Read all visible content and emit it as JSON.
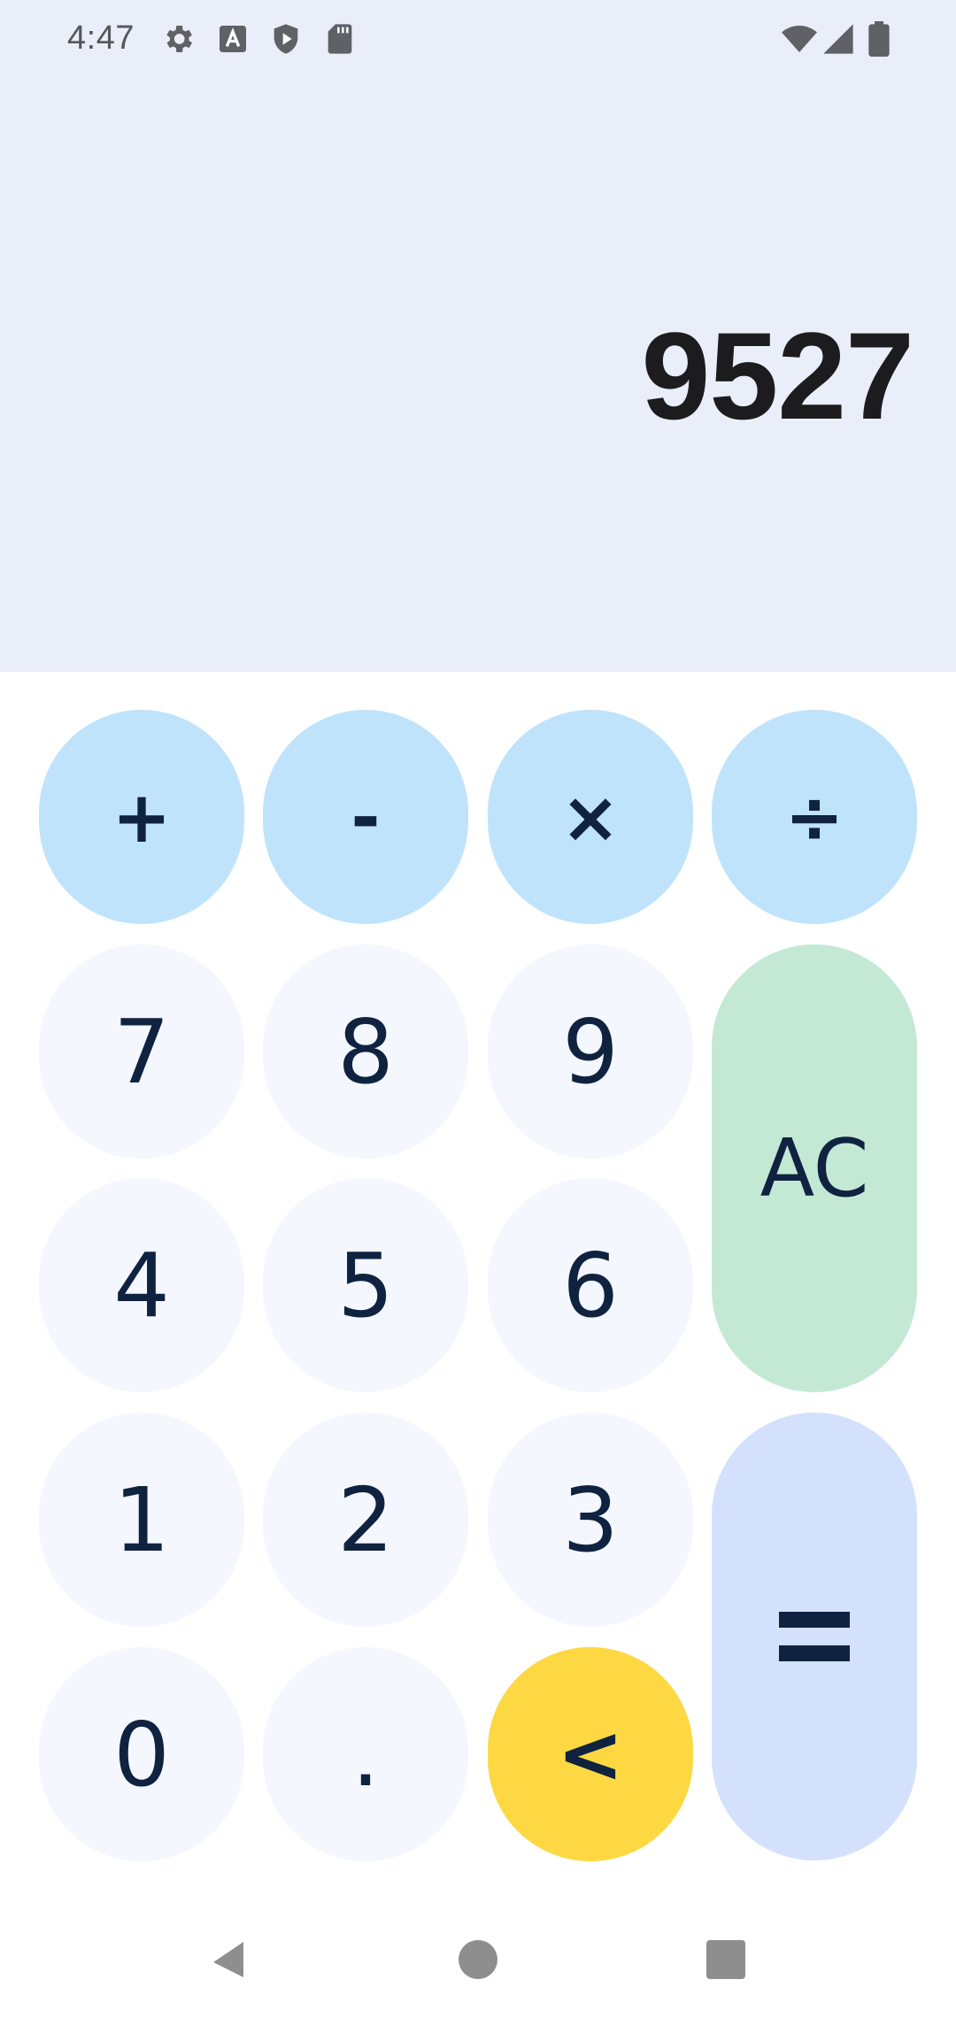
{
  "status_bar": {
    "time": "4:47",
    "left_icons": [
      "settings-icon",
      "text-a-icon",
      "shield-play-icon",
      "sd-card-icon"
    ],
    "right_icons": [
      "wifi-icon",
      "cellular-signal-icon",
      "battery-icon"
    ]
  },
  "display": {
    "value": "9527",
    "background": "#e9eef9"
  },
  "keypad": {
    "operators": [
      {
        "label": "+",
        "name": "add"
      },
      {
        "label": "-",
        "name": "subtract"
      },
      {
        "label": "×",
        "name": "multiply"
      },
      {
        "label": "÷",
        "name": "divide"
      }
    ],
    "digits": {
      "seven": "7",
      "eight": "8",
      "nine": "9",
      "four": "4",
      "five": "5",
      "six": "6",
      "one": "1",
      "two": "2",
      "three": "3",
      "zero": "0",
      "dot": "."
    },
    "clear": "AC",
    "backspace": "<",
    "equals_icon": "equals-icon"
  },
  "colors": {
    "operator_key": "#c0e3fc",
    "digit_key": "#f4f7fd",
    "clear_key": "#c3e9d5",
    "equals_key": "#d3e1fd",
    "backspace_key": "#fdd843",
    "key_text": "#0f2340"
  },
  "navigation": {
    "items": [
      "back-icon",
      "home-icon",
      "recents-icon"
    ]
  }
}
